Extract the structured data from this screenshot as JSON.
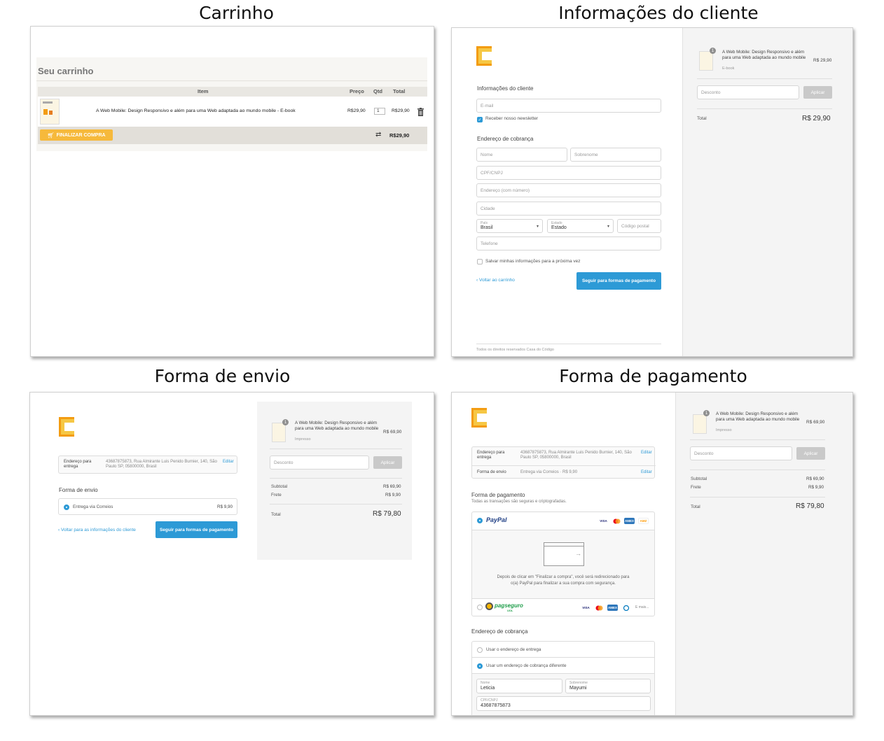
{
  "captions": {
    "cart": "Carrinho",
    "client": "Informações do cliente",
    "shipping": "Forma de envio",
    "payment": "Forma de pagamento"
  },
  "colors": {
    "accent": "#2d9ad6",
    "brand": "#f39c12",
    "cta_yellow": "#f6b93b"
  },
  "cart": {
    "title": "Seu carrinho",
    "headers": {
      "item": "Item",
      "price": "Preço",
      "qty": "Qtd",
      "total": "Total"
    },
    "row": {
      "name": "A Web Mobile: Design Responsivo e além para uma Web adaptada ao mundo mobile - E-book",
      "price": "R$29,90",
      "qty": "1",
      "total": "R$29,90"
    },
    "checkout_label": "FINALIZAR COMPRA",
    "grand_total": "R$29,90"
  },
  "client": {
    "section_title": "Informações do cliente",
    "email_placeholder": "E-mail",
    "newsletter_label": "Receber nosso newsletter",
    "billing_title": "Endereço de cobrança",
    "name_placeholder": "Nome",
    "surname_placeholder": "Sobrenome",
    "cpf_placeholder": "CPF/CNPJ",
    "address_placeholder": "Endereço (com número)",
    "city_placeholder": "Cidade",
    "country_label": "País",
    "country_value": "Brasil",
    "state_label": "Estado",
    "state_value": "Estado",
    "zip_placeholder": "Código postal",
    "phone_placeholder": "Telefone",
    "save_info_label": "Salvar minhas informações para a próxima vez",
    "back_link": "‹ Voltar ao carrinho",
    "continue_button": "Seguir para formas de pagamento",
    "footer": "Todos os direitos reservados Casa do Código",
    "summary": {
      "product": "A Web Mobile: Design Responsivo e além para uma Web adaptada ao mundo mobile",
      "variant": "E-book",
      "qty_badge": "1",
      "price": "R$ 29,90",
      "discount_placeholder": "Desconto",
      "apply_label": "Aplicar",
      "total_label": "Total",
      "total_value": "R$ 29,90"
    }
  },
  "shipping": {
    "ship_to_label": "Endereço para entrega",
    "ship_to_value": "43687875873, Rua Almirante Luis Penido Burnier, 140, São Paulo SP, 05800000, Brasil",
    "edit_label": "Editar",
    "section_title": "Forma de envio",
    "option_label": "Entrega via Correios",
    "option_price": "R$ 9,90",
    "back_link": "‹ Voltar para as informações do cliente",
    "continue_button": "Seguir para formas de pagamento",
    "summary": {
      "product": "A Web Mobile: Design Responsivo e além para uma Web adaptada ao mundo mobile",
      "variant": "Impresso",
      "qty_badge": "1",
      "price": "R$ 69,90",
      "discount_placeholder": "Desconto",
      "apply_label": "Aplicar",
      "subtotal_label": "Subtotal",
      "subtotal_value": "R$ 69,90",
      "freight_label": "Frete",
      "freight_value": "R$ 9,90",
      "total_label": "Total",
      "total_value": "R$ 79,80"
    }
  },
  "payment": {
    "ship_to_label": "Endereço para entrega",
    "ship_to_value": "43687875873, Rua Almirante Luis Penido Burnier, 140, São Paulo SP, 05800000, Brasil",
    "ship_method_label": "Forma de envio",
    "ship_method_value": "Entrega via Correios · R$ 9,90",
    "edit_label": "Editar",
    "section_title": "Forma de pagamento",
    "section_sub": "Todas as transações são seguras e criptografadas.",
    "paypal_label": "PayPal",
    "paypal_info": "Depois de clicar em \"Finalizar a compra\", você será redirecionado para o(a) PayPal para finalizar a sua compra com segurança.",
    "pagseguro_label": "pagseguro",
    "pagseguro_sub": "UOL",
    "more_cards": "E mais...",
    "cards": [
      "VISA",
      "MC",
      "AMEX",
      "AMZ"
    ],
    "billing_title": "Endereço de cobrança",
    "billing_same": "Usar o endereço de entrega",
    "billing_diff": "Usar um endereço de cobrança diferente",
    "name_label": "Nome",
    "name_value": "Leticia",
    "surname_label": "Sobrenome",
    "surname_value": "Mayumi",
    "cpf_label": "CPF/CNPJ",
    "cpf_value": "43687875873",
    "summary": {
      "product": "A Web Mobile: Design Responsivo e além para uma Web adaptada ao mundo mobile",
      "variant": "Impresso",
      "qty_badge": "1",
      "price": "R$ 69,90",
      "discount_placeholder": "Desconto",
      "apply_label": "Aplicar",
      "subtotal_label": "Subtotal",
      "subtotal_value": "R$ 69,90",
      "freight_label": "Frete",
      "freight_value": "R$ 9,90",
      "total_label": "Total",
      "total_value": "R$ 79,80"
    }
  }
}
